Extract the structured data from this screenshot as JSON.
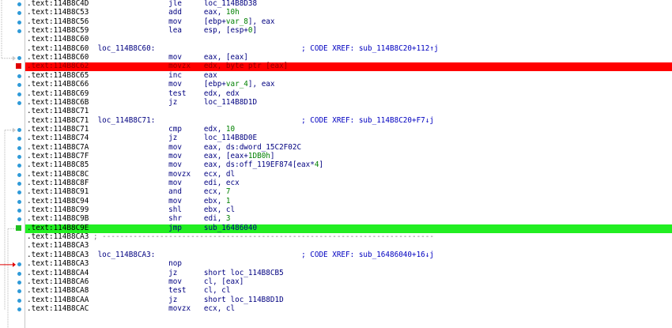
{
  "colors": {
    "background": "#ffffff",
    "text": "#000080",
    "segment_text": "#000000",
    "comment": "#0000c0",
    "number": "#008000",
    "gutter_dot": "#2f9ad8",
    "breakpoint_row": "#ff0000",
    "breakpoint_marker": "#e00000",
    "current_row": "#22ee22",
    "current_marker": "#20c020",
    "flow_arrow": "#c8c8c8",
    "active_arrow": "#e00000",
    "separator_dash": "#808080"
  },
  "rows": [
    {
      "seg": ".text:114B8C4D",
      "label": "",
      "mnem": "jle",
      "ops": [
        {
          "t": "loc_114B8D38"
        }
      ],
      "comment": "",
      "dot": true,
      "state": ""
    },
    {
      "seg": ".text:114B8C53",
      "label": "",
      "mnem": "add",
      "ops": [
        {
          "t": "eax, "
        },
        {
          "t": "10h",
          "k": "num"
        }
      ],
      "comment": "",
      "dot": true,
      "state": ""
    },
    {
      "seg": ".text:114B8C56",
      "label": "",
      "mnem": "mov",
      "ops": [
        {
          "t": "[ebp+"
        },
        {
          "t": "var_8",
          "k": "var"
        },
        {
          "t": "], eax"
        }
      ],
      "comment": "",
      "dot": true,
      "state": ""
    },
    {
      "seg": ".text:114B8C59",
      "label": "",
      "mnem": "lea",
      "ops": [
        {
          "t": "esp, [esp+"
        },
        {
          "t": "0",
          "k": "num"
        },
        {
          "t": "]"
        }
      ],
      "comment": "",
      "dot": true,
      "state": ""
    },
    {
      "seg": ".text:114B8C60",
      "label": "",
      "mnem": "",
      "ops": [],
      "comment": "",
      "dot": false,
      "state": ""
    },
    {
      "seg": ".text:114B8C60",
      "label": "loc_114B8C60:",
      "mnem": "",
      "ops": [],
      "comment": "; CODE XREF: sub_114B8C20+112↑j",
      "dot": false,
      "state": ""
    },
    {
      "seg": ".text:114B8C60",
      "label": "",
      "mnem": "mov",
      "ops": [
        {
          "t": "eax, [eax]"
        }
      ],
      "comment": "",
      "dot": true,
      "state": ""
    },
    {
      "seg": ".text:114B8C62",
      "label": "",
      "mnem": "movzx",
      "ops": [
        {
          "t": "edx, byte ptr [eax]"
        }
      ],
      "comment": "",
      "dot": false,
      "state": "breakpoint"
    },
    {
      "seg": ".text:114B8C65",
      "label": "",
      "mnem": "inc",
      "ops": [
        {
          "t": "eax"
        }
      ],
      "comment": "",
      "dot": true,
      "state": ""
    },
    {
      "seg": ".text:114B8C66",
      "label": "",
      "mnem": "mov",
      "ops": [
        {
          "t": "[ebp+"
        },
        {
          "t": "var_4",
          "k": "var"
        },
        {
          "t": "], eax"
        }
      ],
      "comment": "",
      "dot": true,
      "state": ""
    },
    {
      "seg": ".text:114B8C69",
      "label": "",
      "mnem": "test",
      "ops": [
        {
          "t": "edx, edx"
        }
      ],
      "comment": "",
      "dot": true,
      "state": ""
    },
    {
      "seg": ".text:114B8C6B",
      "label": "",
      "mnem": "jz",
      "ops": [
        {
          "t": "loc_114B8D1D"
        }
      ],
      "comment": "",
      "dot": true,
      "state": ""
    },
    {
      "seg": ".text:114B8C71",
      "label": "",
      "mnem": "",
      "ops": [],
      "comment": "",
      "dot": false,
      "state": ""
    },
    {
      "seg": ".text:114B8C71",
      "label": "loc_114B8C71:",
      "mnem": "",
      "ops": [],
      "comment": "; CODE XREF: sub_114B8C20+F7↓j",
      "dot": false,
      "state": ""
    },
    {
      "seg": ".text:114B8C71",
      "label": "",
      "mnem": "cmp",
      "ops": [
        {
          "t": "edx, "
        },
        {
          "t": "10",
          "k": "num"
        }
      ],
      "comment": "",
      "dot": true,
      "state": ""
    },
    {
      "seg": ".text:114B8C74",
      "label": "",
      "mnem": "jz",
      "ops": [
        {
          "t": "loc_114B8D0E"
        }
      ],
      "comment": "",
      "dot": true,
      "state": ""
    },
    {
      "seg": ".text:114B8C7A",
      "label": "",
      "mnem": "mov",
      "ops": [
        {
          "t": "eax, ds:dword_15C2F02C"
        }
      ],
      "comment": "",
      "dot": true,
      "state": ""
    },
    {
      "seg": ".text:114B8C7F",
      "label": "",
      "mnem": "mov",
      "ops": [
        {
          "t": "eax, [eax+"
        },
        {
          "t": "1DB0h",
          "k": "num"
        },
        {
          "t": "]"
        }
      ],
      "comment": "",
      "dot": true,
      "state": ""
    },
    {
      "seg": ".text:114B8C85",
      "label": "",
      "mnem": "mov",
      "ops": [
        {
          "t": "eax, ds:off_119EF874[eax*"
        },
        {
          "t": "4",
          "k": "num"
        },
        {
          "t": "]"
        }
      ],
      "comment": "",
      "dot": true,
      "state": ""
    },
    {
      "seg": ".text:114B8C8C",
      "label": "",
      "mnem": "movzx",
      "ops": [
        {
          "t": "ecx, dl"
        }
      ],
      "comment": "",
      "dot": true,
      "state": ""
    },
    {
      "seg": ".text:114B8C8F",
      "label": "",
      "mnem": "mov",
      "ops": [
        {
          "t": "edi, ecx"
        }
      ],
      "comment": "",
      "dot": true,
      "state": ""
    },
    {
      "seg": ".text:114B8C91",
      "label": "",
      "mnem": "and",
      "ops": [
        {
          "t": "ecx, "
        },
        {
          "t": "7",
          "k": "num"
        }
      ],
      "comment": "",
      "dot": true,
      "state": ""
    },
    {
      "seg": ".text:114B8C94",
      "label": "",
      "mnem": "mov",
      "ops": [
        {
          "t": "ebx, "
        },
        {
          "t": "1",
          "k": "num"
        }
      ],
      "comment": "",
      "dot": true,
      "state": ""
    },
    {
      "seg": ".text:114B8C99",
      "label": "",
      "mnem": "shl",
      "ops": [
        {
          "t": "ebx, cl"
        }
      ],
      "comment": "",
      "dot": true,
      "state": ""
    },
    {
      "seg": ".text:114B8C9B",
      "label": "",
      "mnem": "shr",
      "ops": [
        {
          "t": "edi, "
        },
        {
          "t": "3",
          "k": "num"
        }
      ],
      "comment": "",
      "dot": true,
      "state": ""
    },
    {
      "seg": ".text:114B8C9E",
      "label": "",
      "mnem": "jmp",
      "ops": [
        {
          "t": "sub_16486040"
        }
      ],
      "comment": "",
      "dot": false,
      "state": "current"
    },
    {
      "seg": ".text:114B8CA3",
      "label": "",
      "mnem": "",
      "ops": [],
      "comment": "",
      "dot": false,
      "state": "",
      "separator": "; ---------------------------------------------------------------------------"
    },
    {
      "seg": ".text:114B8CA3",
      "label": "",
      "mnem": "",
      "ops": [],
      "comment": "",
      "dot": false,
      "state": ""
    },
    {
      "seg": ".text:114B8CA3",
      "label": "loc_114B8CA3:",
      "mnem": "",
      "ops": [],
      "comment": "; CODE XREF: sub_16486040+16↓j",
      "dot": false,
      "state": ""
    },
    {
      "seg": ".text:114B8CA3",
      "label": "",
      "mnem": "nop",
      "ops": [],
      "comment": "",
      "dot": true,
      "state": ""
    },
    {
      "seg": ".text:114B8CA4",
      "label": "",
      "mnem": "jz",
      "ops": [
        {
          "t": "short loc_114B8CB5"
        }
      ],
      "comment": "",
      "dot": true,
      "state": ""
    },
    {
      "seg": ".text:114B8CA6",
      "label": "",
      "mnem": "mov",
      "ops": [
        {
          "t": "cl, [eax]"
        }
      ],
      "comment": "",
      "dot": true,
      "state": ""
    },
    {
      "seg": ".text:114B8CA8",
      "label": "",
      "mnem": "test",
      "ops": [
        {
          "t": "cl, cl"
        }
      ],
      "comment": "",
      "dot": true,
      "state": ""
    },
    {
      "seg": ".text:114B8CAA",
      "label": "",
      "mnem": "jz",
      "ops": [
        {
          "t": "short loc_114B8D1D"
        }
      ],
      "comment": "",
      "dot": true,
      "state": ""
    },
    {
      "seg": ".text:114B8CAC",
      "label": "",
      "mnem": "movzx",
      "ops": [
        {
          "t": "ecx, cl"
        }
      ],
      "comment": "",
      "dot": true,
      "state": ""
    }
  ]
}
